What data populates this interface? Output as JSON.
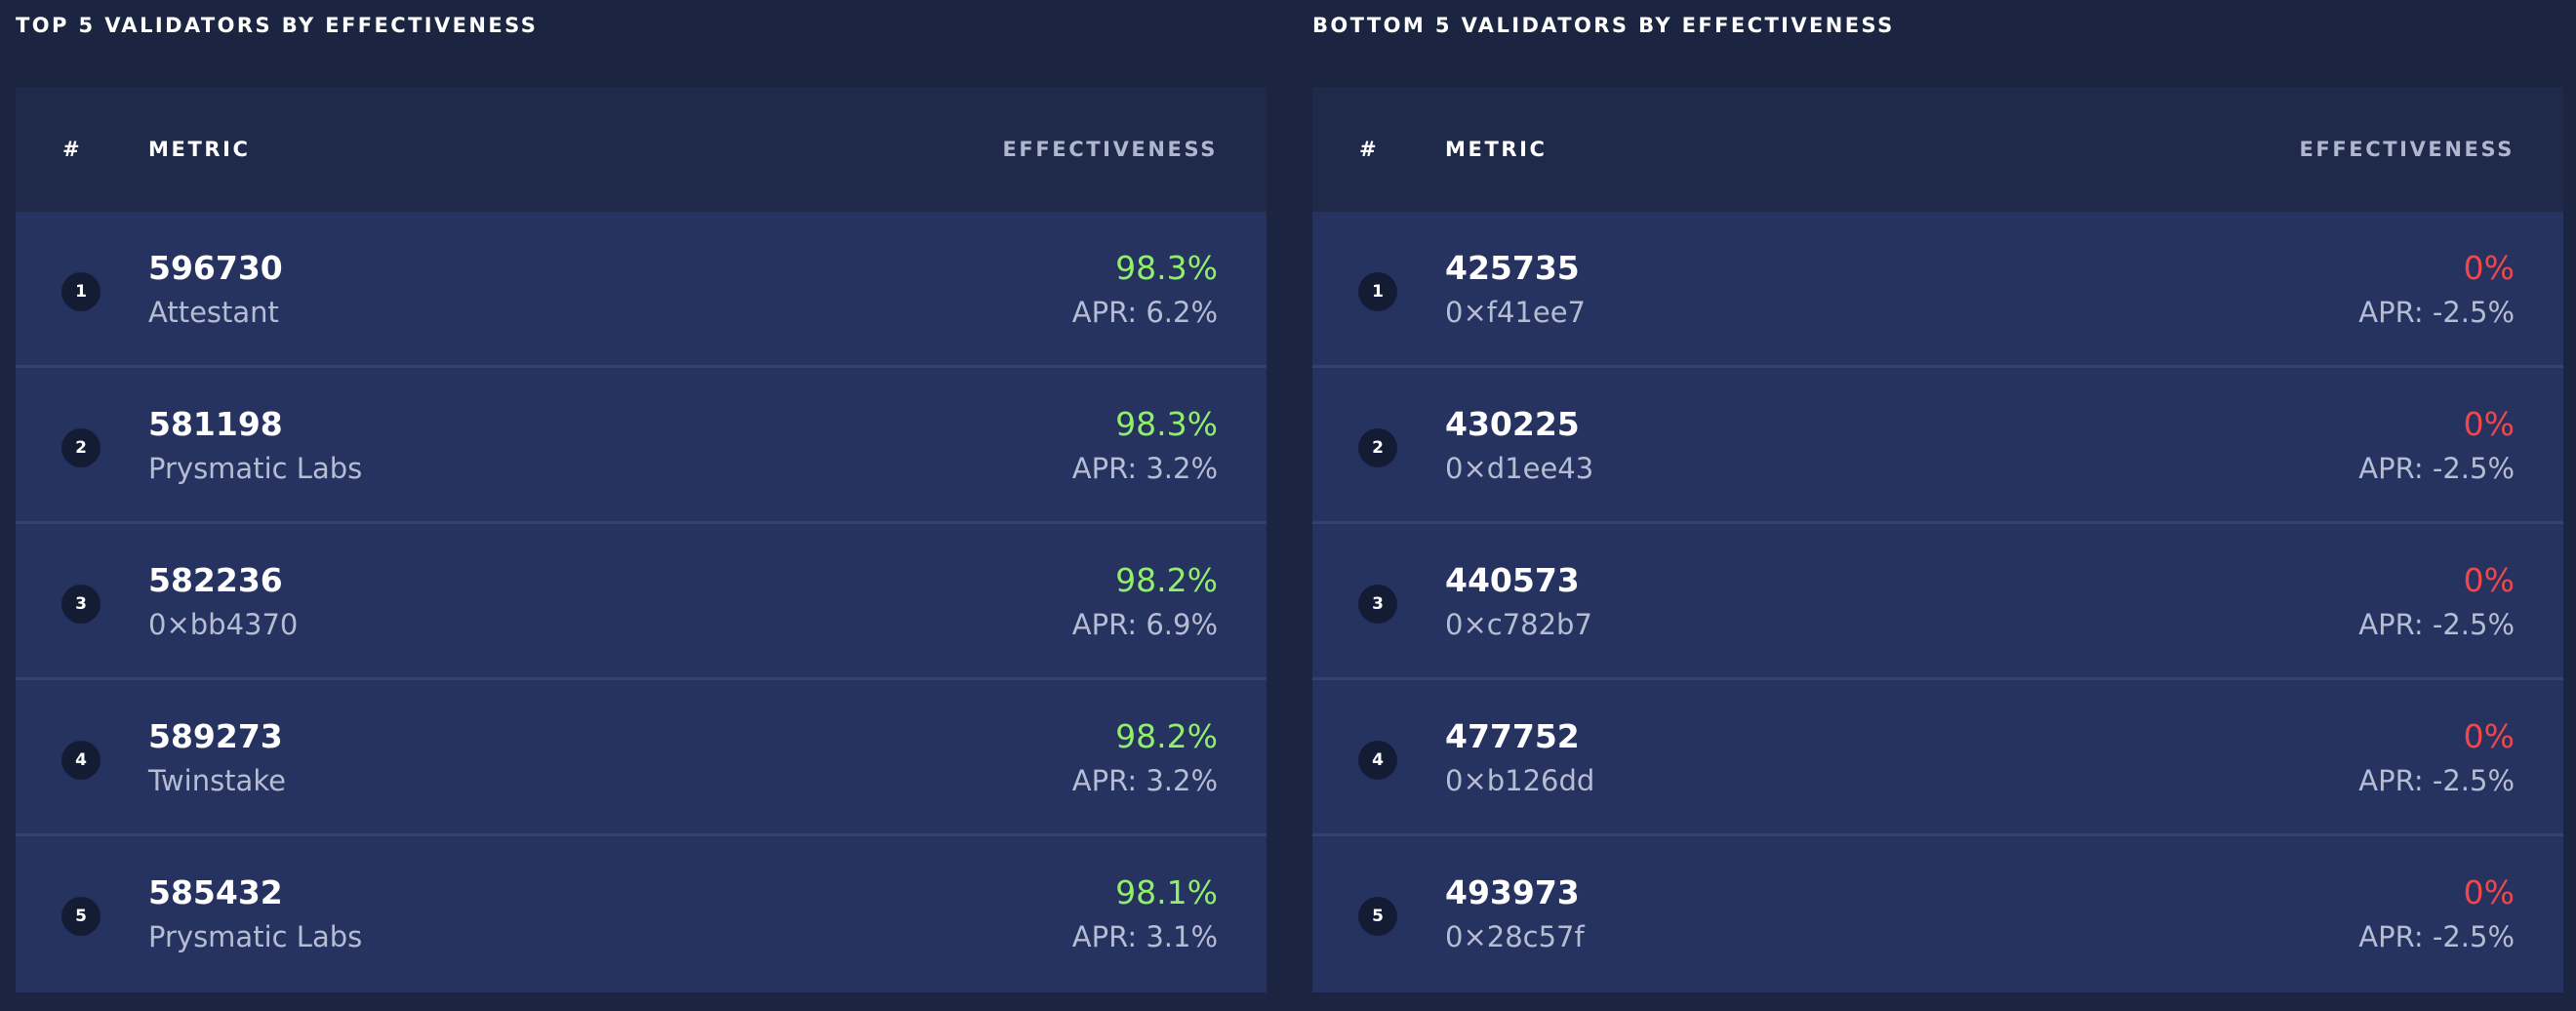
{
  "top_panel": {
    "title": "TOP 5 VALIDATORS BY EFFECTIVENESS",
    "headers": {
      "num": "#",
      "metric": "METRIC",
      "effectiveness": "EFFECTIVENESS"
    },
    "rows": [
      {
        "rank": "1",
        "id": "596730",
        "name": "Attestant",
        "effectiveness": "98.3%",
        "apr": "APR: 6.2%"
      },
      {
        "rank": "2",
        "id": "581198",
        "name": "Prysmatic Labs",
        "effectiveness": "98.3%",
        "apr": "APR: 3.2%"
      },
      {
        "rank": "3",
        "id": "582236",
        "name": "0×bb4370",
        "effectiveness": "98.2%",
        "apr": "APR: 6.9%"
      },
      {
        "rank": "4",
        "id": "589273",
        "name": "Twinstake",
        "effectiveness": "98.2%",
        "apr": "APR: 3.2%"
      },
      {
        "rank": "5",
        "id": "585432",
        "name": "Prysmatic Labs",
        "effectiveness": "98.1%",
        "apr": "APR: 3.1%"
      }
    ]
  },
  "bottom_panel": {
    "title": "BOTTOM 5 VALIDATORS BY EFFECTIVENESS",
    "headers": {
      "num": "#",
      "metric": "METRIC",
      "effectiveness": "EFFECTIVENESS"
    },
    "rows": [
      {
        "rank": "1",
        "id": "425735",
        "name": "0×f41ee7",
        "effectiveness": "0%",
        "apr": "APR: -2.5%"
      },
      {
        "rank": "2",
        "id": "430225",
        "name": "0×d1ee43",
        "effectiveness": "0%",
        "apr": "APR: -2.5%"
      },
      {
        "rank": "3",
        "id": "440573",
        "name": "0×c782b7",
        "effectiveness": "0%",
        "apr": "APR: -2.5%"
      },
      {
        "rank": "4",
        "id": "477752",
        "name": "0×b126dd",
        "effectiveness": "0%",
        "apr": "APR: -2.5%"
      },
      {
        "rank": "5",
        "id": "493973",
        "name": "0×28c57f",
        "effectiveness": "0%",
        "apr": "APR: -2.5%"
      }
    ]
  },
  "colors": {
    "background": "#1b2440",
    "good_effectiveness": "#8ef06b",
    "bad_effectiveness": "#f0484b"
  }
}
